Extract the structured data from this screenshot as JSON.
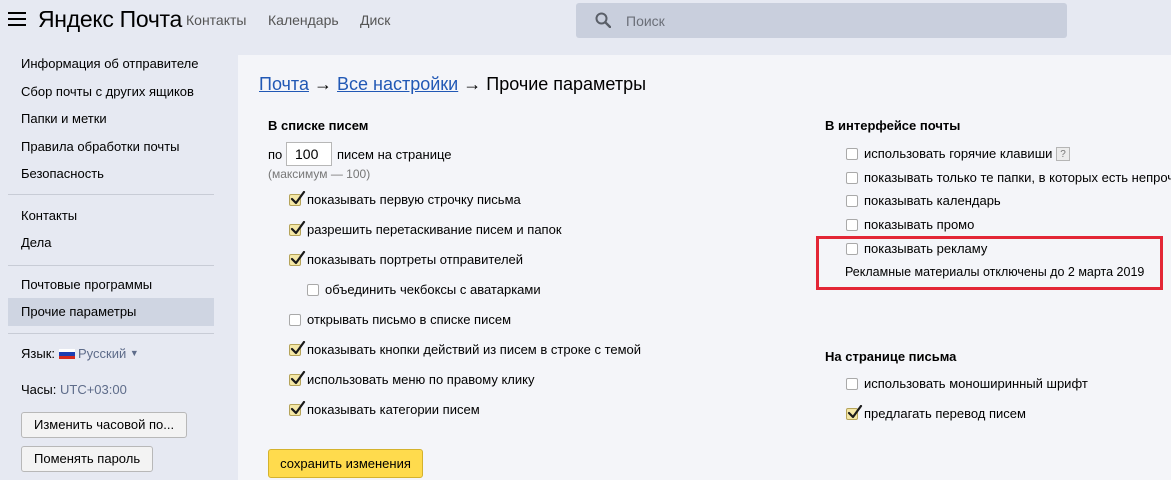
{
  "header": {
    "logo": "Яндекс Почта",
    "nav": [
      "Контакты",
      "Календарь",
      "Диск"
    ],
    "search_placeholder": "Поиск"
  },
  "sidebar": {
    "group1": [
      "Информация об отправителе",
      "Сбор почты с других ящиков",
      "Папки и метки",
      "Правила обработки почты",
      "Безопасность"
    ],
    "group2": [
      "Контакты",
      "Дела"
    ],
    "group3": [
      "Почтовые программы",
      "Прочие параметры"
    ],
    "active_item": "Прочие параметры",
    "language_label": "Язык:",
    "language_value": "Русский",
    "language_arrow": "▼",
    "clock_label": "Часы:",
    "clock_value": "UTC+03:00",
    "change_timezone_button": "Изменить часовой по...",
    "change_password_button": "Поменять пароль"
  },
  "breadcrumb": {
    "mail": "Почта",
    "arrow": "→",
    "all_settings": "Все настройки",
    "current": "Прочие параметры"
  },
  "list_section": {
    "title": "В списке писем",
    "per_page_prefix": "по",
    "per_page_value": "100",
    "per_page_suffix": "писем на странице",
    "max_note": "(максимум — 100)",
    "options": [
      {
        "label": "показывать первую строчку письма",
        "checked": true
      },
      {
        "label": "разрешить перетаскивание писем и папок",
        "checked": true
      },
      {
        "label": "показывать портреты отправителей",
        "checked": true
      },
      {
        "label": "объединить чекбоксы с аватарками",
        "checked": false
      },
      {
        "label": "открывать письмо в списке писем",
        "checked": false
      },
      {
        "label": "показывать кнопки действий из писем в строке с темой",
        "checked": true
      },
      {
        "label": "использовать меню по правому клику",
        "checked": true
      },
      {
        "label": "показывать категории писем",
        "checked": true
      }
    ],
    "save_button": "сохранить изменения"
  },
  "interface_section": {
    "title": "В интерфейсе почты",
    "options": [
      {
        "label": "использовать горячие клавиши",
        "checked": false
      },
      {
        "label": "показывать только те папки, в которых есть непрочитанные",
        "checked": false
      },
      {
        "label": "показывать календарь",
        "checked": false
      },
      {
        "label": "показывать промо",
        "checked": false
      },
      {
        "label": "показывать рекламу",
        "checked": false
      }
    ],
    "help_icon": "?",
    "ads_note": "Рекламные материалы отключены до 2 марта 2019"
  },
  "letter_section": {
    "title": "На странице письма",
    "options": [
      {
        "label": "использовать моноширинный шрифт",
        "checked": false
      },
      {
        "label": "предлагать перевод писем",
        "checked": true
      }
    ]
  },
  "colors": {
    "accent_yellow": "#ffdb4d",
    "link_blue": "#2158b5",
    "highlight_red": "#e32636"
  }
}
